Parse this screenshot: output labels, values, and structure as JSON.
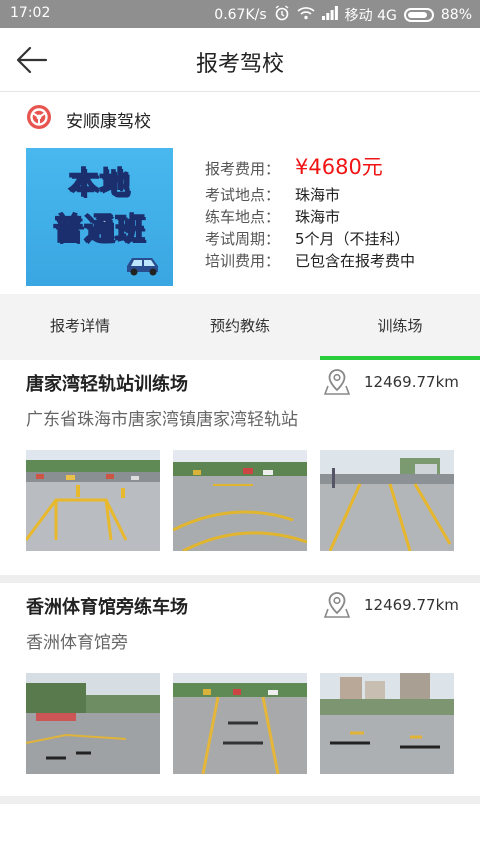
{
  "status_bar": {
    "time": "17:02",
    "speed": "0.67K/s",
    "carrier": "移动 4G",
    "battery": "88%",
    "battery_level": 0.88
  },
  "header": {
    "title": "报考驾校",
    "back_icon": "arrow-left-icon"
  },
  "school": {
    "name": "安顺康驾校",
    "logo_icon": "steering-wheel-icon",
    "promo_line1": "本地",
    "promo_line2": "普通班",
    "info": [
      {
        "label": "报考费用：",
        "value": "¥4680元"
      },
      {
        "label": "考试地点：",
        "value": "珠海市"
      },
      {
        "label": "练车地点：",
        "value": "珠海市"
      },
      {
        "label": "考试周期：",
        "value": "5个月（不挂科）"
      },
      {
        "label": "培训费用：",
        "value": "已包含在报考费中"
      }
    ]
  },
  "tabs": [
    {
      "label": "报考详情",
      "active": false
    },
    {
      "label": "预约教练",
      "active": false
    },
    {
      "label": "训练场",
      "active": true
    }
  ],
  "venues": [
    {
      "name": "唐家湾轻轨站训练场",
      "distance": "12469.77km",
      "address": "广东省珠海市唐家湾镇唐家湾轻轨站",
      "location_icon": "location-pin-icon"
    },
    {
      "name": "香洲体育馆旁练车场",
      "distance": "12469.77km",
      "address": "香洲体育馆旁",
      "location_icon": "location-pin-icon"
    }
  ],
  "colors": {
    "accent_green": "#29cc3a",
    "price_red": "#f01414",
    "status_bar": "#8f8f8f"
  }
}
